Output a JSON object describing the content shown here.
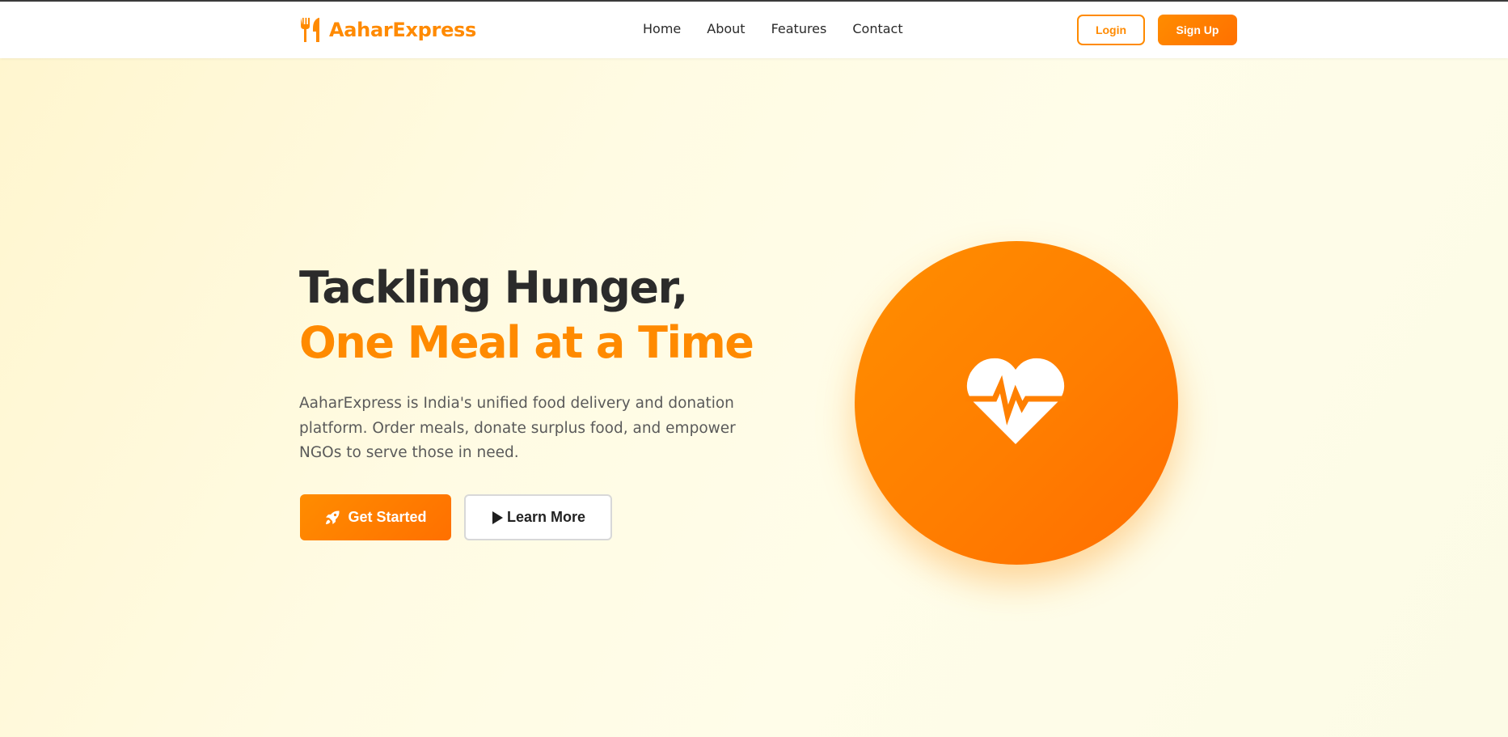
{
  "brand": {
    "name": "AaharExpress",
    "icon": "utensils-icon"
  },
  "nav": {
    "links": [
      "Home",
      "About",
      "Features",
      "Contact"
    ],
    "login_label": "Login",
    "signup_label": "Sign Up"
  },
  "hero": {
    "headline_line1": "Tackling Hunger,",
    "headline_line2": "One Meal at a Time",
    "description": "AaharExpress is India's unified food delivery and donation platform. Order meals, donate surplus food, and empower NGOs to serve those in need.",
    "get_started_label": "Get Started",
    "get_started_icon": "rocket-icon",
    "learn_more_label": "Learn More",
    "learn_more_icon": "play-icon",
    "illustration_icon": "heart-pulse-icon"
  },
  "colors": {
    "accent": "#ff8a00",
    "accent_dark": "#ff7000",
    "heading": "#2b2b2b",
    "body_text": "#5a5a5a",
    "hero_background": "#fffbe3"
  }
}
